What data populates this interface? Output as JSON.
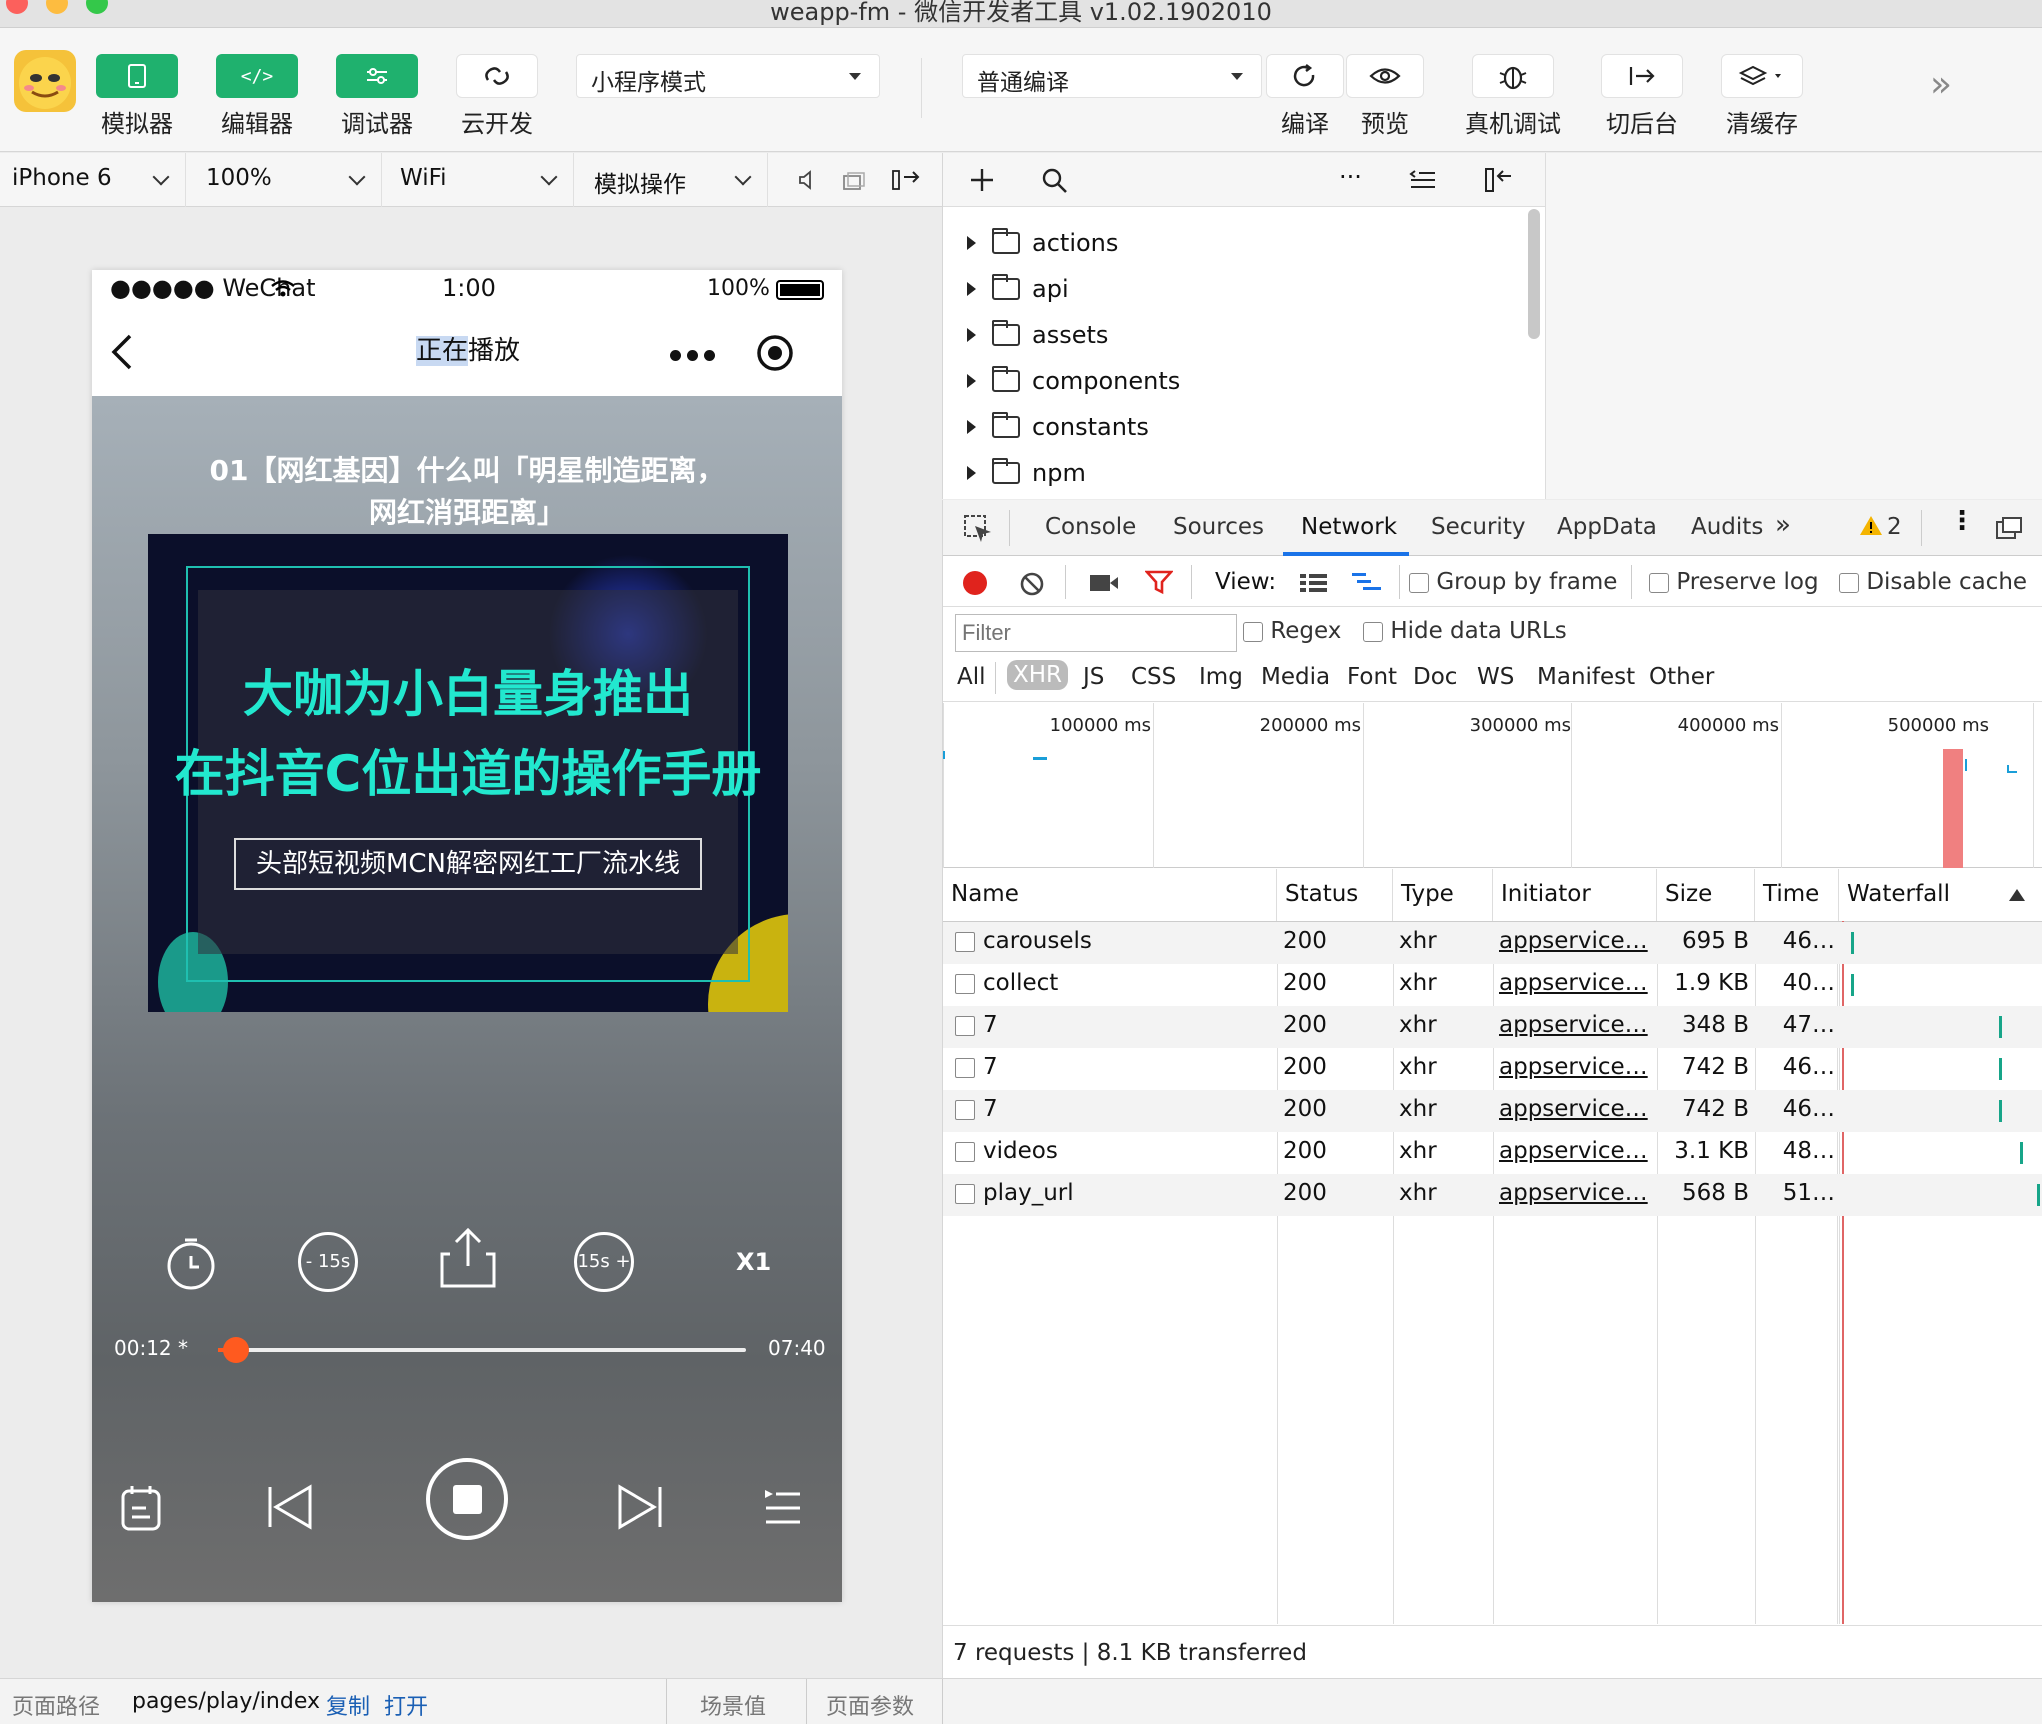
{
  "window": {
    "title": "weapp-fm - 微信开发者工具 v1.02.1902010"
  },
  "toolbar": {
    "simulator": "模拟器",
    "editor": "编辑器",
    "debugger": "调试器",
    "cloud": "云开发",
    "mode": "小程序模式",
    "compile_mode": "普通编译",
    "compile": "编译",
    "preview": "预览",
    "remote_debug": "真机调试",
    "background": "切后台",
    "clear_cache": "清缓存"
  },
  "devbar": {
    "device": "iPhone 6",
    "zoom": "100%",
    "network": "WiFi",
    "simulate": "模拟操作"
  },
  "phone": {
    "status": {
      "carrier": "●●●●● WeChat",
      "time": "1:00",
      "battery": "100%"
    },
    "nav_title_a": "正在",
    "nav_title_b": "播放",
    "episode_title_1": "01【网红基因】什么叫「明星制造距离，",
    "episode_title_2": "网红消弭距离」",
    "cover_line1": "大咖为小白量身推出",
    "cover_line2": "在抖音C位出道的操作手册",
    "cover_sub": "头部短视频MCN解密网红工厂流水线",
    "rewind": "- 15s",
    "forward": "15s +",
    "speed": "X1",
    "time_current": "00:12",
    "time_star": "*",
    "time_total": "07:40",
    "progress": 0.02
  },
  "files": [
    "actions",
    "api",
    "assets",
    "components",
    "constants",
    "npm"
  ],
  "devtools": {
    "tabs": [
      "Console",
      "Sources",
      "Network",
      "Security",
      "AppData",
      "Audits"
    ],
    "active_tab": "Network",
    "warnings": "2",
    "view_label": "View:",
    "group_by_frame": "Group by frame",
    "preserve_log": "Preserve log",
    "disable_cache": "Disable cache",
    "filter_placeholder": "Filter",
    "regex": "Regex",
    "hide_data_urls": "Hide data URLs",
    "types": [
      "All",
      "XHR",
      "JS",
      "CSS",
      "Img",
      "Media",
      "Font",
      "Doc",
      "WS",
      "Manifest",
      "Other"
    ],
    "active_type": "XHR",
    "timeline": [
      "100000 ms",
      "200000 ms",
      "300000 ms",
      "400000 ms",
      "500000 ms"
    ],
    "columns": [
      "Name",
      "Status",
      "Type",
      "Initiator",
      "Size",
      "Time",
      "Waterfall"
    ],
    "rows": [
      {
        "name": "carousels",
        "status": "200",
        "type": "xhr",
        "initiator": "appservice…",
        "size": "695 B",
        "time": "46…",
        "wf": 0.02
      },
      {
        "name": "collect",
        "status": "200",
        "type": "xhr",
        "initiator": "appservice…",
        "size": "1.9 KB",
        "time": "40…",
        "wf": 0.02
      },
      {
        "name": "7",
        "status": "200",
        "type": "xhr",
        "initiator": "appservice…",
        "size": "348 B",
        "time": "47…",
        "wf": 0.8
      },
      {
        "name": "7",
        "status": "200",
        "type": "xhr",
        "initiator": "appservice…",
        "size": "742 B",
        "time": "46…",
        "wf": 0.8
      },
      {
        "name": "7",
        "status": "200",
        "type": "xhr",
        "initiator": "appservice…",
        "size": "742 B",
        "time": "46…",
        "wf": 0.8
      },
      {
        "name": "videos",
        "status": "200",
        "type": "xhr",
        "initiator": "appservice…",
        "size": "3.1 KB",
        "time": "48…",
        "wf": 0.91
      },
      {
        "name": "play_url",
        "status": "200",
        "type": "xhr",
        "initiator": "appservice…",
        "size": "568 B",
        "time": "51…",
        "wf": 1.0
      }
    ],
    "summary": "7 requests | 8.1 KB transferred"
  },
  "bottom": {
    "path_label": "页面路径",
    "path": "pages/play/index",
    "copy": "复制",
    "open": "打开",
    "scene": "场景值",
    "params": "页面参数"
  }
}
